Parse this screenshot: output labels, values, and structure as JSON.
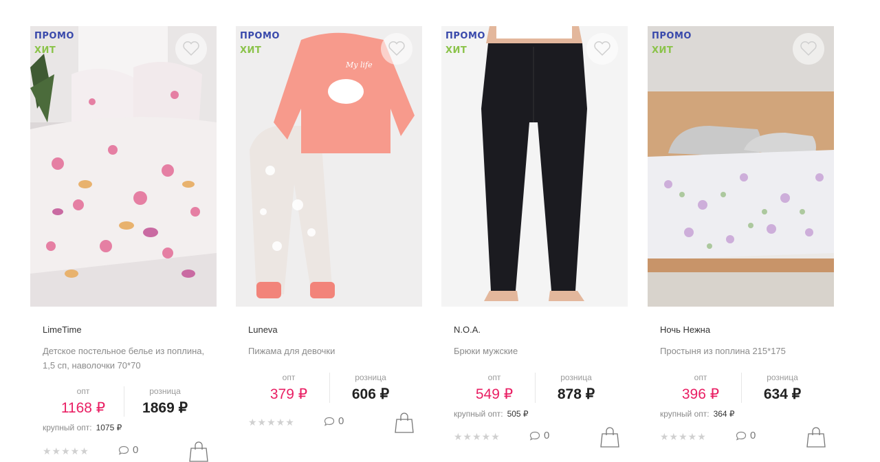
{
  "currency": "₽",
  "labels": {
    "opt": "опт",
    "retail": "розница",
    "bulk": "крупный опт:"
  },
  "products": [
    {
      "badges": [
        "ПРОМО",
        "ХИТ"
      ],
      "brand": "LimeTime",
      "description": "Детское постельное белье из поплина, 1,5 сп, наволочки 70*70",
      "opt_price": "1168 ₽",
      "retail_price": "1869 ₽",
      "bulk_price": "1075 ₽",
      "rating": "★★★★★",
      "comments": "0",
      "image_icon": "bedding-photo"
    },
    {
      "badges": [
        "ПРОМО",
        "ХИТ"
      ],
      "brand": "Luneva",
      "description": "Пижама для девочки",
      "opt_price": "379 ₽",
      "retail_price": "606 ₽",
      "rating": "★★★★★",
      "comments": "0",
      "image_icon": "pajamas-photo",
      "shirt_text": "My life"
    },
    {
      "badges": [
        "ПРОМО",
        "ХИТ"
      ],
      "brand": "N.O.A.",
      "description": "Брюки мужские",
      "opt_price": "549 ₽",
      "retail_price": "878 ₽",
      "bulk_price": "505 ₽",
      "rating": "★★★★★",
      "comments": "0",
      "image_icon": "trousers-photo"
    },
    {
      "badges": [
        "ПРОМО",
        "ХИТ"
      ],
      "brand": "Ночь Нежна",
      "description": "Простыня из поплина 215*175",
      "opt_price": "396 ₽",
      "retail_price": "634 ₽",
      "bulk_price": "364 ₽",
      "rating": "★★★★★",
      "comments": "0",
      "image_icon": "bed-sheet-photo"
    }
  ],
  "colors": {
    "promo": "#3949ab",
    "hit": "#8bc34a",
    "price": "#e91e63"
  }
}
